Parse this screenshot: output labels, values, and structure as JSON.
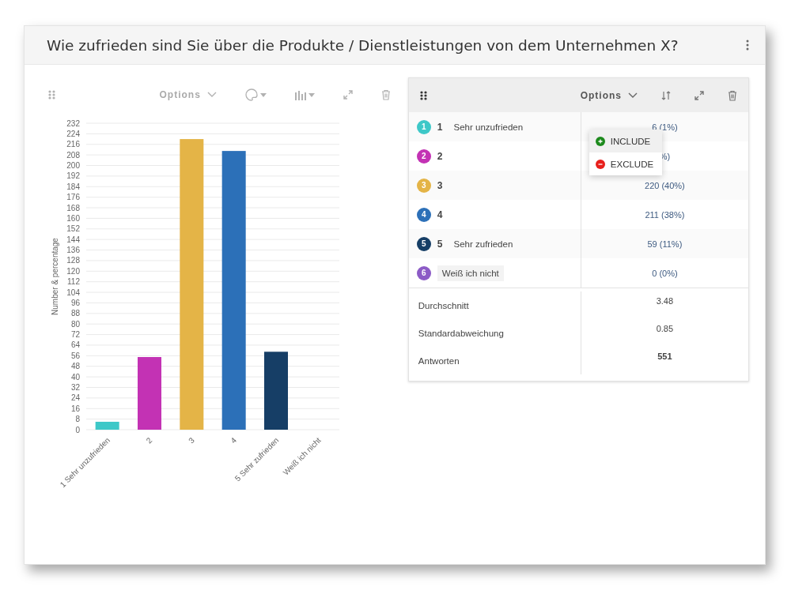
{
  "header": {
    "title": "Wie zufrieden sind Sie über die Produkte / Dienstleistungen von dem Unternehmen X?"
  },
  "chart_panel": {
    "toolbar": {
      "options_label": "Options",
      "disabled": true
    },
    "chart_data": {
      "type": "bar",
      "ylabel": "Number & percentage",
      "categories": [
        "1 Sehr unzufrieden",
        "2",
        "3",
        "4",
        "5 Sehr zufrieden",
        "Weiß ich nicht"
      ],
      "values": [
        6,
        55,
        220,
        211,
        59,
        0
      ],
      "grid": true,
      "colors": [
        "#3ec8c8",
        "#c332b4",
        "#e4b447",
        "#2c70b8",
        "#163e66",
        "#8c5bc6"
      ],
      "ylim": [
        0,
        232
      ],
      "yticks": [
        0,
        8,
        16,
        24,
        32,
        40,
        48,
        56,
        64,
        72,
        80,
        88,
        96,
        104,
        112,
        120,
        128,
        136,
        144,
        152,
        160,
        168,
        176,
        184,
        192,
        200,
        208,
        216,
        224,
        232
      ]
    }
  },
  "table_panel": {
    "options_label": "Options",
    "rows": [
      {
        "number": "1",
        "label": "1",
        "sublabel": "Sehr unzufrieden",
        "value": "6 (1%)",
        "color": "#3ec8c8"
      },
      {
        "number": "2",
        "label": "2",
        "value": "%)",
        "color": "#c332b4"
      },
      {
        "number": "3",
        "label": "3",
        "value": "220 (40%)",
        "color": "#e4b447"
      },
      {
        "number": "4",
        "label": "4",
        "value": "211 (38%)",
        "color": "#2c70b8"
      },
      {
        "number": "5",
        "label": "5",
        "sublabel": "Sehr zufrieden",
        "value": "59 (11%)",
        "color": "#163e66"
      },
      {
        "number": "6",
        "sublabel": "Weiß ich nicht",
        "value": "0 (0%)",
        "color": "#8c5bc6"
      }
    ],
    "stats": [
      {
        "label": "Durchschnitt",
        "value": "3.48",
        "bold": false
      },
      {
        "label": "Standardabweichung",
        "value": "0.85",
        "bold": false
      },
      {
        "label": "Antworten",
        "value": "551",
        "bold": true
      }
    ],
    "context_menu": {
      "items": [
        {
          "label": "INCLUDE",
          "kind": "include",
          "selected": true
        },
        {
          "label": "EXCLUDE",
          "kind": "exclude",
          "selected": false
        }
      ]
    }
  }
}
